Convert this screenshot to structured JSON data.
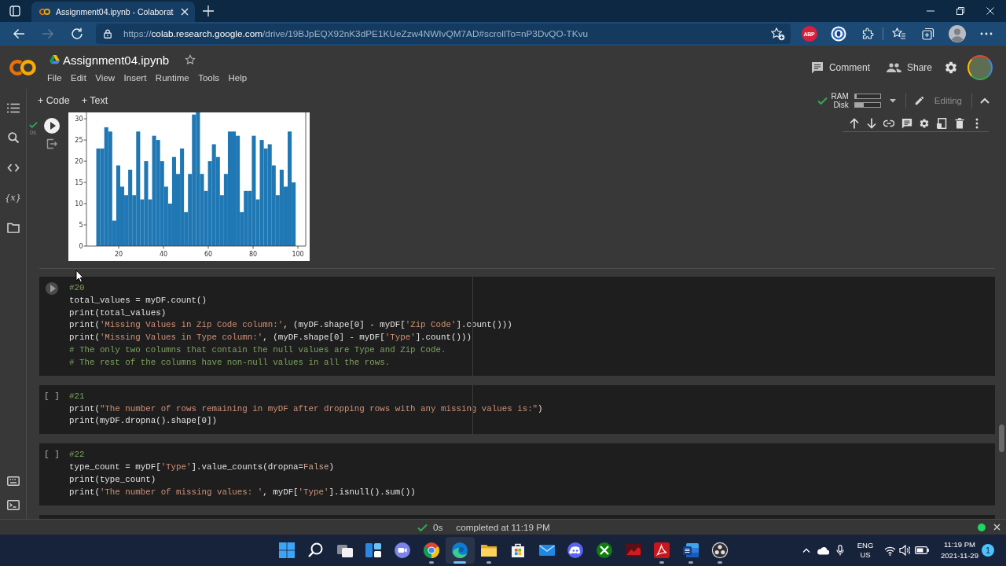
{
  "browser": {
    "tabs": [
      {
        "title": "Assignment04.ipynb - Colaborat",
        "selected": true
      }
    ],
    "nav_buttons": [
      {
        "disabled": false
      },
      {
        "disabled": true
      },
      {
        "disabled": false
      }
    ],
    "url": {
      "scheme": "https://",
      "host": "colab.research.google.com",
      "path": "/drive/19BJpEQX92nK3dPE1KUeZzw4NWIvQM7AD#scrollTo=nP3DvQO-TKvu"
    },
    "extension_badge": "ABP"
  },
  "notebook": {
    "title": "Assignment04.ipynb",
    "starred": false,
    "menu": [
      "File",
      "Edit",
      "View",
      "Insert",
      "Runtime",
      "Tools",
      "Help"
    ],
    "comment_button": "Comment",
    "share_button": "Share",
    "toolbar": {
      "add_code": "+ Code",
      "add_text": "+ Text",
      "connected": true,
      "ram": {
        "label": "RAM",
        "level": 0.08
      },
      "disk": {
        "label": "Disk",
        "level": 0.35
      },
      "mode": "Editing"
    },
    "sidebar": {
      "variables_label": "{x}"
    },
    "cells": [
      {
        "kind": "output",
        "selected": true,
        "status": {
          "done": true,
          "time": "0s"
        },
        "chart_data": [
          {
            "type": "histogram",
            "bins": [
              10,
              11.78,
              13.56,
              15.34,
              17.12,
              18.9,
              20.68,
              22.46,
              24.24,
              26.02,
              27.8,
              29.58,
              31.36,
              33.14,
              34.92,
              36.7,
              38.48,
              40.26,
              42.04,
              43.82,
              45.6,
              47.38,
              49.16,
              50.94,
              52.72,
              54.5,
              56.28,
              58.06,
              59.84,
              61.62,
              63.4,
              65.18,
              66.96,
              68.74,
              70.52,
              72.3,
              74.08,
              75.86,
              77.64,
              79.42,
              81.2,
              82.98,
              84.76,
              86.54,
              88.32,
              90.1,
              91.88,
              93.66,
              95.44,
              97.22,
              99
            ],
            "values": [
              23,
              23,
              28,
              27,
              6,
              19,
              14,
              12,
              18,
              12,
              27,
              11,
              20,
              11,
              26,
              25,
              20,
              14,
              10,
              21,
              17,
              23,
              8,
              17,
              31,
              31.5,
              17,
              13,
              20,
              24,
              21,
              12,
              17,
              27,
              27,
              26,
              8,
              13,
              13,
              26,
              11,
              25,
              23,
              24,
              19,
              12,
              18,
              14,
              27,
              15
            ],
            "color": "#1f77b4",
            "xlim": [
              5.6,
              103.5
            ],
            "ylim": [
              0,
              31.5
            ],
            "xticks": [
              20,
              40,
              60,
              80,
              100
            ],
            "yticks": [
              0,
              5,
              10,
              15,
              20,
              25,
              30
            ]
          }
        ]
      },
      {
        "kind": "code",
        "selected": false,
        "hovered": true,
        "ruler": true,
        "lines": [
          [
            {
              "kind": "comment",
              "text": "#20"
            }
          ],
          [
            {
              "kind": "plain",
              "text": "total_values = myDF.count()"
            }
          ],
          [
            {
              "kind": "plain",
              "text": "print(total_values)"
            }
          ],
          [
            {
              "kind": "plain",
              "text": "print("
            },
            {
              "kind": "string",
              "text": "'Missing Values in Zip Code column:'"
            },
            {
              "kind": "plain",
              "text": ", (myDF.shape[0] - myDF["
            },
            {
              "kind": "string",
              "text": "'Zip Code'"
            },
            {
              "kind": "plain",
              "text": "].count()))"
            }
          ],
          [
            {
              "kind": "plain",
              "text": "print("
            },
            {
              "kind": "string",
              "text": "'Missing Values in Type column:'"
            },
            {
              "kind": "plain",
              "text": ", (myDF.shape[0] - myDF["
            },
            {
              "kind": "string",
              "text": "'Type'"
            },
            {
              "kind": "plain",
              "text": "].count()))"
            }
          ],
          [
            {
              "kind": "comment",
              "text": "# The only two columns that contain the null values are Type and Zip Code."
            }
          ],
          [
            {
              "kind": "comment",
              "text": "# The rest of the columns have non-null values in all the rows."
            }
          ]
        ]
      },
      {
        "kind": "code",
        "selected": false,
        "hovered": false,
        "ruler": true,
        "prompt": "[ ]",
        "lines": [
          [
            {
              "kind": "comment",
              "text": "#21"
            }
          ],
          [
            {
              "kind": "plain",
              "text": "print("
            },
            {
              "kind": "string",
              "text": "\"The number of rows remaining in myDF after dropping rows with any missing values is:\""
            },
            {
              "kind": "plain",
              "text": ")"
            }
          ],
          [
            {
              "kind": "plain",
              "text": "print(myDF.dropna().shape[0])"
            }
          ]
        ]
      },
      {
        "kind": "code",
        "selected": false,
        "hovered": false,
        "ruler": false,
        "prompt": "[ ]",
        "lines": [
          [
            {
              "kind": "comment",
              "text": "#22"
            }
          ],
          [
            {
              "kind": "plain",
              "text": "type_count = myDF["
            },
            {
              "kind": "string",
              "text": "'Type'"
            },
            {
              "kind": "plain",
              "text": "].value_counts(dropna="
            },
            {
              "kind": "keyword",
              "text": "False"
            },
            {
              "kind": "plain",
              "text": ")"
            }
          ],
          [
            {
              "kind": "plain",
              "text": "print(type_count)"
            }
          ],
          [
            {
              "kind": "plain",
              "text": "print("
            },
            {
              "kind": "string",
              "text": "'The number of missing values: '"
            },
            {
              "kind": "plain",
              "text": ", myDF["
            },
            {
              "kind": "string",
              "text": "'Type'"
            },
            {
              "kind": "plain",
              "text": "].isnull().sum())"
            }
          ]
        ]
      }
    ],
    "status_bar": {
      "success": true,
      "duration": "0s",
      "message": "completed at 11:19 PM"
    }
  },
  "taskbar": {
    "apps": [
      {
        "running": false,
        "selected": false
      },
      {
        "running": false,
        "selected": false
      },
      {
        "running": false,
        "selected": false
      },
      {
        "running": false,
        "selected": false
      },
      {
        "running": false,
        "selected": false
      },
      {
        "running": true,
        "selected": false
      },
      {
        "running": true,
        "selected": true
      },
      {
        "running": true,
        "selected": false
      },
      {
        "running": false,
        "selected": false
      },
      {
        "running": false,
        "selected": false
      },
      {
        "running": false,
        "selected": false
      },
      {
        "running": false,
        "selected": false
      },
      {
        "running": false,
        "selected": false
      },
      {
        "running": true,
        "selected": false
      },
      {
        "running": true,
        "selected": false
      },
      {
        "running": true,
        "selected": false
      }
    ],
    "tray": {
      "language": "ENG",
      "region": "US",
      "time": "11:19 PM",
      "date": "2021-11-29",
      "notifications": "1"
    }
  }
}
